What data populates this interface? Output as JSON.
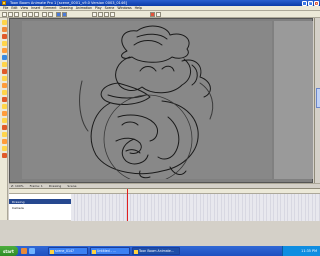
{
  "window": {
    "title": "Toon Boom Animate Pro 1 [scene_0001_v9.0 Version 0003_0146]",
    "controls": [
      "_",
      "□",
      "×"
    ]
  },
  "menu": {
    "items": [
      "File",
      "Edit",
      "View",
      "Insert",
      "Element",
      "Drawing",
      "Animation",
      "Play",
      "Scene",
      "Windows",
      "Help"
    ]
  },
  "toolbar": {
    "buttons": [
      "new-doc",
      "open",
      "save",
      "cut",
      "copy",
      "paste",
      "undo",
      "redo",
      "zoom-in",
      "zoom-out",
      "play",
      "stop",
      "loop",
      "onion-skin",
      "light-table",
      "camera"
    ]
  },
  "tools": [
    "select",
    "contour-editor",
    "brush",
    "pencil",
    "eraser",
    "paint",
    "dropper",
    "line",
    "rectangle",
    "ellipse",
    "text",
    "cutter",
    "transform",
    "pivot",
    "hand",
    "zoom",
    "rotate",
    "morph",
    "ink",
    "stroke"
  ],
  "status": {
    "items": [
      "Z: 100%",
      "Frame: 1",
      "Drawing",
      "Scene"
    ]
  },
  "timeline": {
    "layers": [
      "Drawing",
      "Camera"
    ],
    "current_frame": 18
  },
  "taskbar": {
    "start": "start",
    "tasks": [
      "scene_0147",
      "Untitled - ...",
      "Toon Boom Animate..."
    ],
    "clock": "11:35 PM"
  }
}
